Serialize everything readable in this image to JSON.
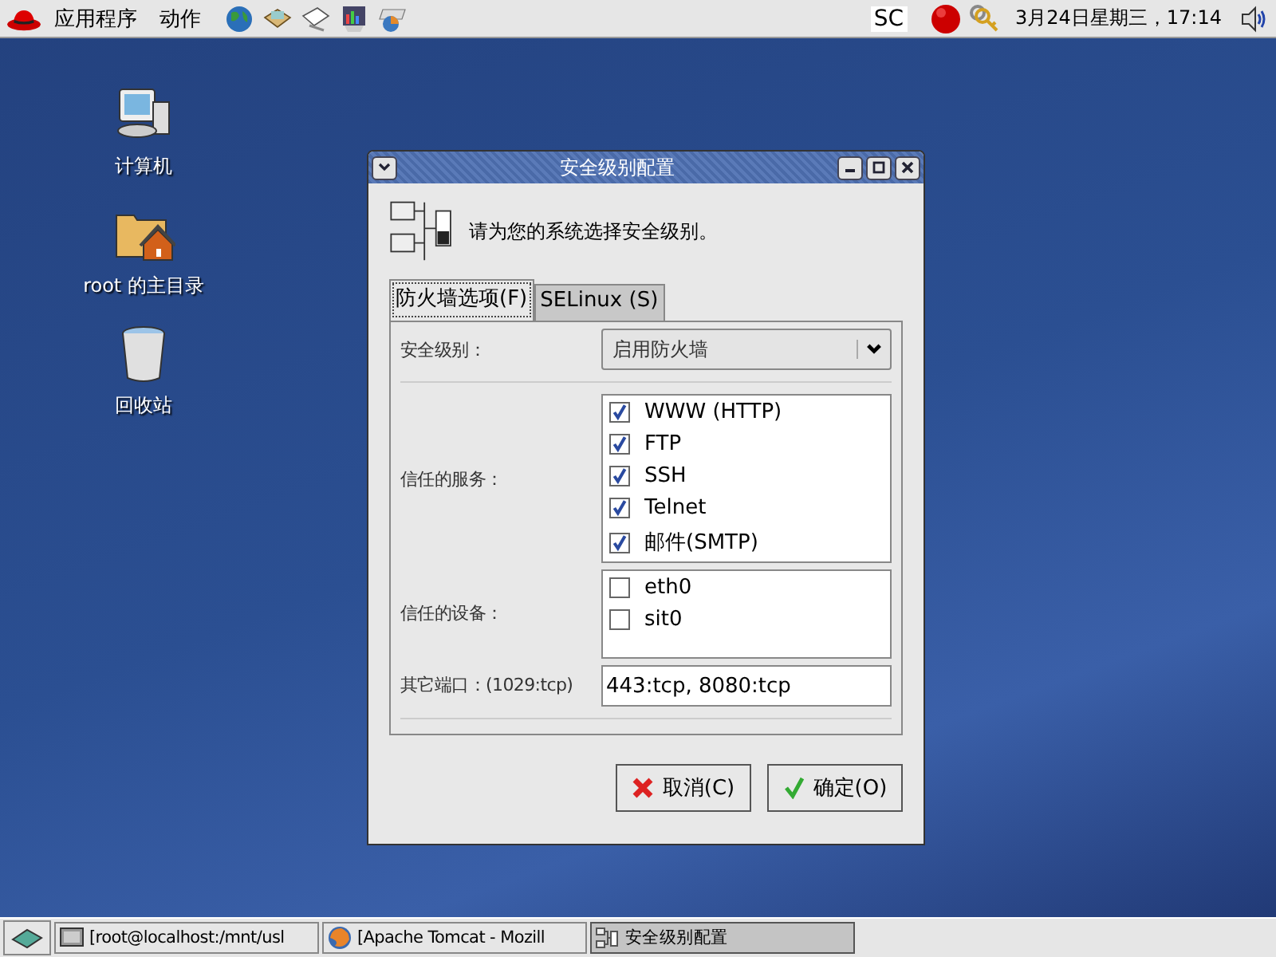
{
  "top_panel": {
    "menus": [
      "应用程序",
      "动作"
    ],
    "launchers": [
      {
        "kind": "globe"
      },
      {
        "kind": "mail"
      },
      {
        "kind": "document"
      },
      {
        "kind": "chart"
      },
      {
        "kind": "pie"
      }
    ],
    "indicator": "SC",
    "clock": "3月24日星期三，17:14"
  },
  "desktop_icons": [
    {
      "label": "计算机",
      "kind": "computer"
    },
    {
      "label": "root 的主目录",
      "kind": "home"
    },
    {
      "label": "回收站",
      "kind": "trash"
    }
  ],
  "dialog": {
    "title": "安全级别配置",
    "prompt": "请为您的系统选择安全级别。",
    "tabs": [
      {
        "label": "防火墙选项(F)",
        "selected": true
      },
      {
        "label": "SELinux (S)",
        "selected": false
      }
    ],
    "security_level": {
      "label": "安全级别：",
      "value": "启用防火墙"
    },
    "services": {
      "label": "信任的服务：",
      "items": [
        {
          "label": "WWW (HTTP)",
          "checked": true
        },
        {
          "label": "FTP",
          "checked": true
        },
        {
          "label": "SSH",
          "checked": true
        },
        {
          "label": "Telnet",
          "checked": true
        },
        {
          "label": "邮件(SMTP)",
          "checked": true
        }
      ]
    },
    "devices": {
      "label": "信任的设备：",
      "items": [
        {
          "label": "eth0",
          "checked": false
        },
        {
          "label": "sit0",
          "checked": false
        }
      ]
    },
    "other_ports": {
      "label": "其它端口：(1029:tcp)",
      "value": "443:tcp, 8080:tcp"
    },
    "buttons": [
      {
        "label": "取消(C)",
        "kind": "cancel"
      },
      {
        "label": "确定(O)",
        "kind": "ok"
      }
    ]
  },
  "taskbar": [
    {
      "label": "[root@localhost:/mnt/usl",
      "kind": "terminal",
      "selected": false
    },
    {
      "label": "[Apache Tomcat - Mozill",
      "kind": "browser",
      "selected": false
    },
    {
      "label": "安全级别配置",
      "kind": "config",
      "selected": true
    }
  ]
}
